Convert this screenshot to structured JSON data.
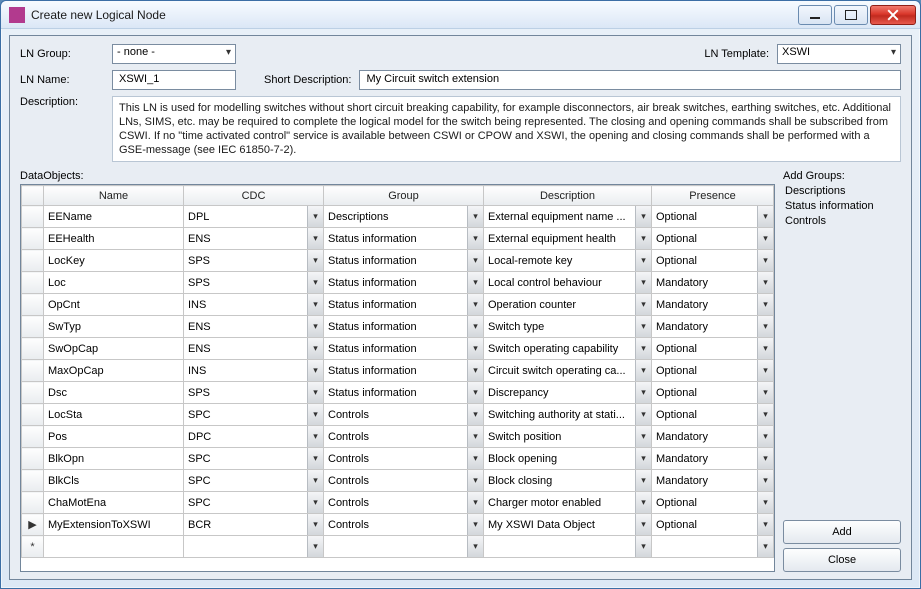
{
  "window": {
    "title": "Create new Logical Node"
  },
  "form": {
    "ln_group_label": "LN Group:",
    "ln_group_value": "- none -",
    "ln_template_label": "LN Template:",
    "ln_template_value": "XSWI",
    "ln_name_label": "LN Name:",
    "ln_name_value": "XSWI_1",
    "short_desc_label": "Short Description:",
    "short_desc_value": "My Circuit switch extension",
    "desc_label": "Description:",
    "desc_value": "This LN is used for modelling switches without short circuit breaking capability, for example disconnectors, air break switches, earthing switches, etc. Additional LNs, SIMS, etc. may be required to complete the logical model for the switch being represented. The closing and opening commands shall be subscribed from CSWI. If no \"time activated control\" service is available between CSWI or CPOW and XSWI, the opening and closing commands shall be performed with a GSE-message (see IEC 61850-7-2)."
  },
  "grid": {
    "label": "DataObjects:",
    "columns": {
      "name": "Name",
      "cdc": "CDC",
      "group": "Group",
      "desc": "Description",
      "presence": "Presence"
    },
    "rows": [
      {
        "name": "EEName",
        "cdc": "DPL",
        "group": "Descriptions",
        "desc": "External equipment name ...",
        "presence": "Optional"
      },
      {
        "name": "EEHealth",
        "cdc": "ENS",
        "group": "Status information",
        "desc": "External equipment health",
        "presence": "Optional"
      },
      {
        "name": "LocKey",
        "cdc": "SPS",
        "group": "Status information",
        "desc": "Local-remote key",
        "presence": "Optional"
      },
      {
        "name": "Loc",
        "cdc": "SPS",
        "group": "Status information",
        "desc": "Local control behaviour",
        "presence": "Mandatory"
      },
      {
        "name": "OpCnt",
        "cdc": "INS",
        "group": "Status information",
        "desc": "Operation counter",
        "presence": "Mandatory"
      },
      {
        "name": "SwTyp",
        "cdc": "ENS",
        "group": "Status information",
        "desc": "Switch type",
        "presence": "Mandatory"
      },
      {
        "name": "SwOpCap",
        "cdc": "ENS",
        "group": "Status information",
        "desc": "Switch operating capability",
        "presence": "Optional"
      },
      {
        "name": "MaxOpCap",
        "cdc": "INS",
        "group": "Status information",
        "desc": "Circuit switch operating ca...",
        "presence": "Optional"
      },
      {
        "name": "Dsc",
        "cdc": "SPS",
        "group": "Status information",
        "desc": "Discrepancy",
        "presence": "Optional"
      },
      {
        "name": "LocSta",
        "cdc": "SPC",
        "group": "Controls",
        "desc": "Switching authority at stati...",
        "presence": "Optional"
      },
      {
        "name": "Pos",
        "cdc": "DPC",
        "group": "Controls",
        "desc": "Switch position",
        "presence": "Mandatory"
      },
      {
        "name": "BlkOpn",
        "cdc": "SPC",
        "group": "Controls",
        "desc": "Block opening",
        "presence": "Mandatory"
      },
      {
        "name": "BlkCls",
        "cdc": "SPC",
        "group": "Controls",
        "desc": "Block closing",
        "presence": "Mandatory"
      },
      {
        "name": "ChaMotEna",
        "cdc": "SPC",
        "group": "Controls",
        "desc": "Charger motor enabled",
        "presence": "Optional"
      },
      {
        "name": "MyExtensionToXSWI",
        "cdc": "BCR",
        "group": "Controls",
        "desc": "My XSWI Data Object",
        "presence": "Optional",
        "current": true
      }
    ]
  },
  "side": {
    "label": "Add Groups:",
    "items": [
      "Descriptions",
      "Status information",
      "Controls"
    ],
    "add_label": "Add",
    "close_label": "Close"
  }
}
